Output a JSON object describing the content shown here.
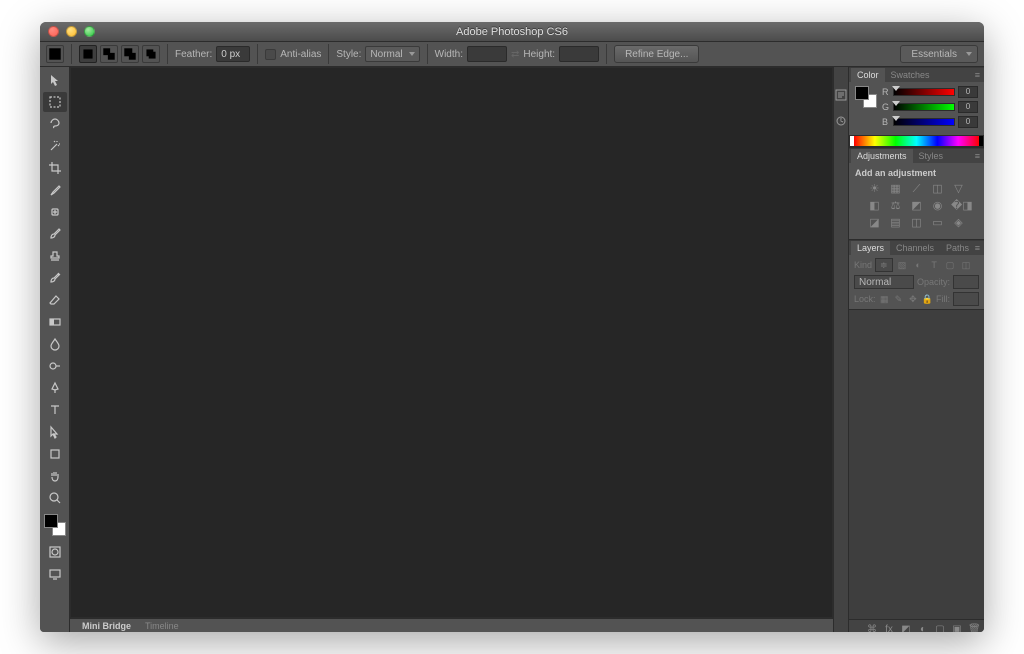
{
  "app": {
    "title": "Adobe Photoshop CS6"
  },
  "workspace": {
    "selected": "Essentials"
  },
  "options": {
    "feather_label": "Feather:",
    "feather_value": "0 px",
    "antialias_label": "Anti-alias",
    "style_label": "Style:",
    "style_value": "Normal",
    "width_label": "Width:",
    "width_value": "",
    "height_label": "Height:",
    "height_value": "",
    "refine_label": "Refine Edge..."
  },
  "panels": {
    "color": {
      "tab1": "Color",
      "tab2": "Swatches",
      "r_label": "R",
      "r_val": "0",
      "g_label": "G",
      "g_val": "0",
      "b_label": "B",
      "b_val": "0"
    },
    "adjustments": {
      "tab1": "Adjustments",
      "tab2": "Styles",
      "heading": "Add an adjustment"
    },
    "layers": {
      "tab1": "Layers",
      "tab2": "Channels",
      "tab3": "Paths",
      "kind_label": "Kind",
      "blend": "Normal",
      "opacity_label": "Opacity:",
      "opacity_val": "",
      "lock_label": "Lock:",
      "fill_label": "Fill:",
      "fill_val": ""
    }
  },
  "bottom": {
    "tab1": "Mini Bridge",
    "tab2": "Timeline"
  }
}
